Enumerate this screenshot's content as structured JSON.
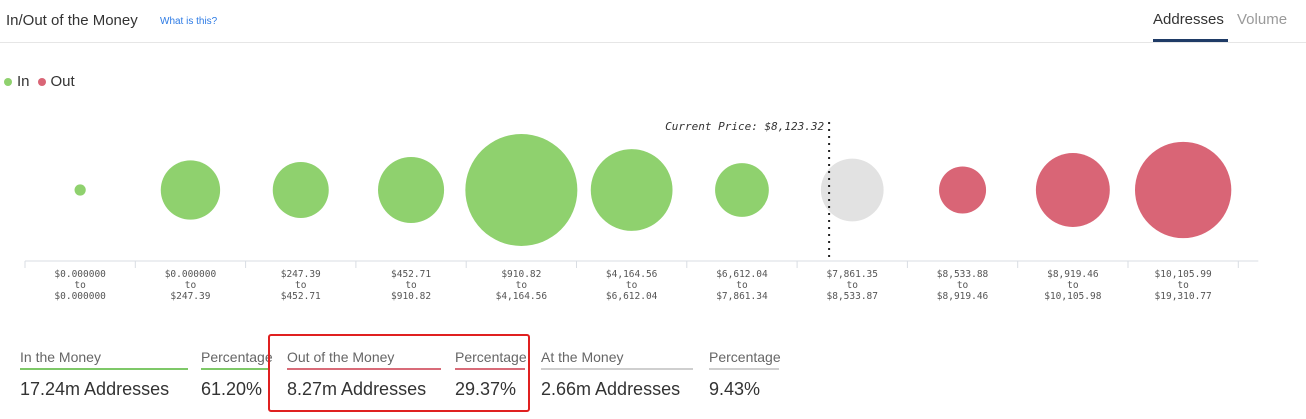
{
  "header": {
    "title": "In/Out of the Money",
    "help_link": "What is this?",
    "tabs": [
      {
        "label": "Addresses",
        "active": true
      },
      {
        "label": "Volume",
        "active": false
      }
    ]
  },
  "legend": [
    {
      "label": "In",
      "color": "#8fd16e"
    },
    {
      "label": "Out",
      "color": "#d96576"
    }
  ],
  "chart_data": {
    "type": "bubble",
    "current_price_label": "Current Price: $8,123.32",
    "bubbles": [
      {
        "from": "$0.000000",
        "to": "$0.000000",
        "status": "in",
        "relative_size": 0.1
      },
      {
        "from": "$0.000000",
        "to": "$247.39",
        "status": "in",
        "relative_size": 0.53
      },
      {
        "from": "$247.39",
        "to": "$452.71",
        "status": "in",
        "relative_size": 0.5
      },
      {
        "from": "$452.71",
        "to": "$910.82",
        "status": "in",
        "relative_size": 0.59
      },
      {
        "from": "$910.82",
        "to": "$4,164.56",
        "status": "in",
        "relative_size": 1.0
      },
      {
        "from": "$4,164.56",
        "to": "$6,612.04",
        "status": "in",
        "relative_size": 0.73
      },
      {
        "from": "$6,612.04",
        "to": "$7,861.34",
        "status": "in",
        "relative_size": 0.48
      },
      {
        "from": "$7,861.35",
        "to": "$8,533.87",
        "status": "at",
        "relative_size": 0.56
      },
      {
        "from": "$8,533.88",
        "to": "$8,919.46",
        "status": "out",
        "relative_size": 0.42
      },
      {
        "from": "$8,919.46",
        "to": "$10,105.98",
        "status": "out",
        "relative_size": 0.66
      },
      {
        "from": "$10,105.99",
        "to": "$19,310.77",
        "status": "out",
        "relative_size": 0.86
      }
    ],
    "tick_separator": "to",
    "colors": {
      "in": "#8fd16e",
      "out": "#d96576",
      "at": "#e2e2e2"
    }
  },
  "stats": {
    "in_money": {
      "label": "In the Money",
      "value": "17.24m Addresses",
      "pct_label": "Percentage",
      "pct": "61.20%"
    },
    "out_money": {
      "label": "Out of the Money",
      "value": "8.27m Addresses",
      "pct_label": "Percentage",
      "pct": "29.37%"
    },
    "at_money": {
      "label": "At the Money",
      "value": "2.66m Addresses",
      "pct_label": "Percentage",
      "pct": "9.43%"
    }
  }
}
